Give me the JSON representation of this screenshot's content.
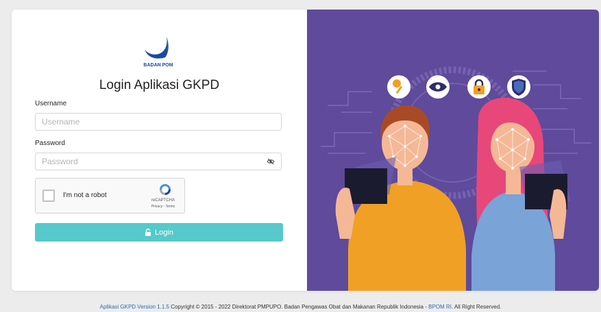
{
  "logo": {
    "text": "BADAN POM"
  },
  "login": {
    "title": "Login Aplikasi GKPD",
    "username_label": "Username",
    "username_placeholder": "Username",
    "password_label": "Password",
    "password_placeholder": "Password",
    "button_label": "Login"
  },
  "recaptcha": {
    "label": "I'm not a robot",
    "brand": "reCAPTCHA",
    "links": "Privacy - Terms"
  },
  "footer": {
    "version_link": "Aplikasi GKPD Version 1.1.5",
    "copyright": " Copyright © 2015 - 2022 Direktorat PMPUPO. Badan Pengawas Obat dan Makanan Republik Indonesia - ",
    "org_link": "BPOM RI",
    "suffix": ". All Right Reserved."
  },
  "colors": {
    "accent": "#55c9cc",
    "illustration_bg": "#5f4a9b",
    "link": "#2b6cb0"
  },
  "icons": [
    "eye-slash-icon",
    "lock-icon",
    "key-icon",
    "eye-icon",
    "padlock-icon",
    "shield-icon"
  ]
}
